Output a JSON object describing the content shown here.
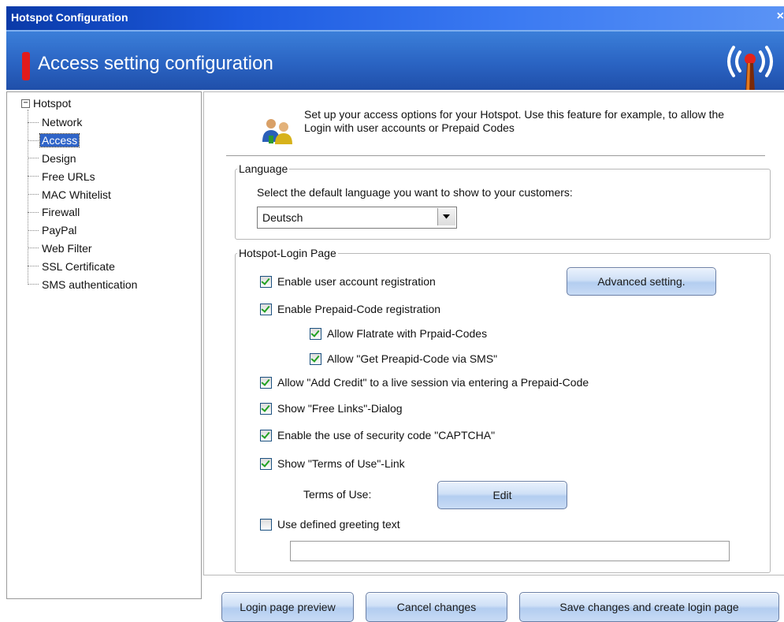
{
  "window": {
    "title": "Hotspot Configuration",
    "close_glyph": "×"
  },
  "header": {
    "title": "Access setting configuration",
    "logo_icon": "antenna-broadcast-icon"
  },
  "tree": {
    "root_label": "Hotspot",
    "expander": "−",
    "items": [
      {
        "label": "Network",
        "selected": false
      },
      {
        "label": "Access",
        "selected": true
      },
      {
        "label": "Design",
        "selected": false
      },
      {
        "label": "Free URLs",
        "selected": false
      },
      {
        "label": "MAC Whitelist",
        "selected": false
      },
      {
        "label": "Firewall",
        "selected": false
      },
      {
        "label": "PayPal",
        "selected": false
      },
      {
        "label": "Web Filter",
        "selected": false
      },
      {
        "label": "SSL Certificate",
        "selected": false
      },
      {
        "label": "SMS authentication",
        "selected": false
      }
    ]
  },
  "intro": {
    "icon": "users-icon",
    "text": "Set up your access options for your Hotspot. Use this feature for example, to allow the Login with user accounts or Prepaid Codes"
  },
  "language": {
    "legend": "Language",
    "prompt": "Select the default language you want to show to your customers:",
    "selected": "Deutsch"
  },
  "login_page": {
    "legend": "Hotspot-Login Page",
    "options": {
      "user_registration": {
        "label": "Enable user account registration",
        "checked": true
      },
      "prepaid_registration": {
        "label": "Enable Prepaid-Code registration",
        "checked": true
      },
      "flatrate": {
        "label": "Allow Flatrate with Prpaid-Codes",
        "checked": true
      },
      "sms_code": {
        "label": "Allow \"Get Preapid-Code via SMS\"",
        "checked": true
      },
      "add_credit": {
        "label": "Allow \"Add Credit\" to a live session via entering a Prepaid-Code",
        "checked": true
      },
      "free_links": {
        "label": "Show \"Free Links\"-Dialog",
        "checked": true
      },
      "captcha": {
        "label": "Enable the use of security code \"CAPTCHA\"",
        "checked": true
      },
      "terms_link": {
        "label": "Show \"Terms of Use\"-Link",
        "checked": true
      },
      "greeting": {
        "label": "Use defined greeting text",
        "checked": false
      }
    },
    "advanced_button": "Advanced setting.",
    "terms_label": "Terms of Use:",
    "edit_button": "Edit",
    "greeting_value": ""
  },
  "footer": {
    "preview_button": "Login page preview",
    "cancel_button": "Cancel changes",
    "save_button": "Save changes and create login page"
  },
  "colors": {
    "title_bar": "#1d5be0",
    "header": "#2a63c2",
    "selection": "#2f64c8",
    "check": "#21a121",
    "accent_red": "#e21b1b"
  }
}
